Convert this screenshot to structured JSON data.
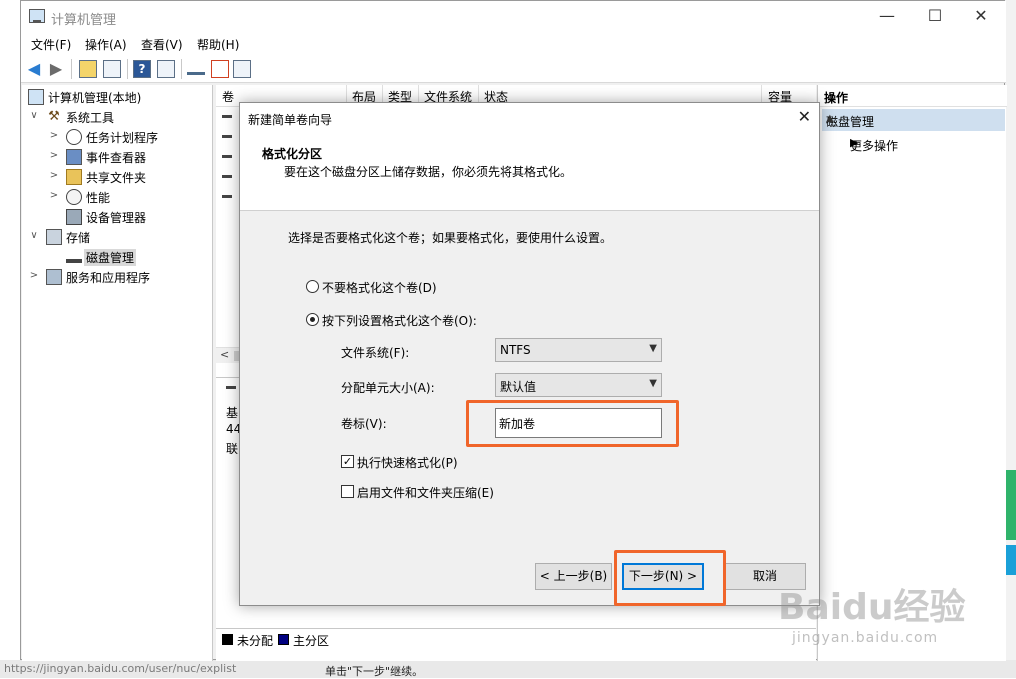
{
  "window": {
    "title": "计算机管理"
  },
  "menu": [
    "文件(F)",
    "操作(A)",
    "查看(V)",
    "帮助(H)"
  ],
  "tree": [
    {
      "label": "计算机管理(本地)",
      "icon": "computer-management-icon",
      "twisty": ""
    },
    {
      "label": "系统工具",
      "icon": "tools-icon",
      "twisty": "∨"
    },
    {
      "label": "任务计划程序",
      "icon": "clock-icon",
      "twisty": ">"
    },
    {
      "label": "事件查看器",
      "icon": "event-viewer-icon",
      "twisty": ">"
    },
    {
      "label": "共享文件夹",
      "icon": "shared-folder-icon",
      "twisty": ">"
    },
    {
      "label": "性能",
      "icon": "performance-icon",
      "twisty": ">"
    },
    {
      "label": "设备管理器",
      "icon": "device-manager-icon",
      "twisty": ""
    },
    {
      "label": "存储",
      "icon": "storage-icon",
      "twisty": "∨"
    },
    {
      "label": "磁盘管理",
      "icon": "disk-management-icon",
      "twisty": ""
    },
    {
      "label": "服务和应用程序",
      "icon": "services-icon",
      "twisty": ">"
    }
  ],
  "columns": [
    "卷",
    "布局",
    "类型",
    "文件系统",
    "状态",
    "容量"
  ],
  "disk_info": [
    "基",
    "44",
    "联"
  ],
  "legend": [
    {
      "label": "未分配",
      "color": "#000000"
    },
    {
      "label": "主分区",
      "color": "#000080"
    }
  ],
  "actions": {
    "header": "操作",
    "section": "磁盘管理",
    "more": "更多操作"
  },
  "wizard": {
    "title": "新建简单卷向导",
    "heading": "格式化分区",
    "subheading": "要在这个磁盘分区上储存数据，你必须先将其格式化。",
    "prompt": "选择是否要格式化这个卷；如果要格式化，要使用什么设置。",
    "opt_no_format": "不要格式化这个卷(D)",
    "opt_format": "按下列设置格式化这个卷(O):",
    "fs_label": "文件系统(F):",
    "fs_value": "NTFS",
    "alloc_label": "分配单元大小(A):",
    "alloc_value": "默认值",
    "vol_label": "卷标(V):",
    "vol_value": "新加卷",
    "quick_format": "执行快速格式化(P)",
    "compress": "启用文件和文件夹压缩(E)",
    "back": "< 上一步(B)",
    "next": "下一步(N) >",
    "cancel": "取消"
  },
  "background": {
    "url": "https://jingyan.baidu.com/user/nuc/explist",
    "tail": "单击\"下一步\"继续。"
  },
  "watermark": {
    "brand": "Baidu经验",
    "sub": "jingyan.baidu.com"
  }
}
